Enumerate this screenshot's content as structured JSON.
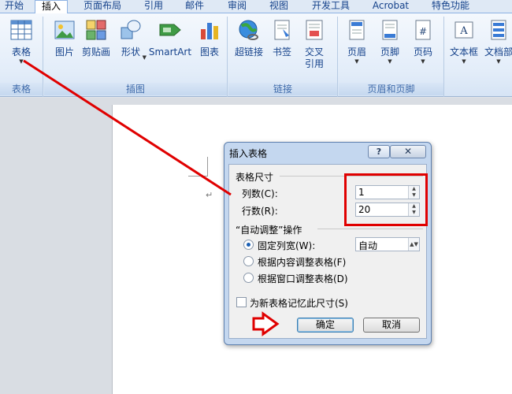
{
  "tabs": [
    {
      "label": "开始",
      "active": false
    },
    {
      "label": "插入",
      "active": true
    },
    {
      "label": "页面布局",
      "active": false
    },
    {
      "label": "引用",
      "active": false
    },
    {
      "label": "邮件",
      "active": false
    },
    {
      "label": "审阅",
      "active": false
    },
    {
      "label": "视图",
      "active": false
    },
    {
      "label": "开发工具",
      "active": false
    },
    {
      "label": "Acrobat",
      "active": false
    },
    {
      "label": "特色功能",
      "active": false
    }
  ],
  "ribbon": {
    "groups": [
      {
        "label": "表格"
      },
      {
        "label": "插图"
      },
      {
        "label": "链接"
      },
      {
        "label": "页眉和页脚"
      },
      {
        "label": ""
      }
    ],
    "buttons": {
      "table": "表格",
      "picture": "图片",
      "clipart": "剪贴画",
      "shapes": "形状",
      "smartart": "SmartArt",
      "chart": "图表",
      "hyperlink": "超链接",
      "bookmark": "书签",
      "crossref_1": "交叉",
      "crossref_2": "引用",
      "header": "页眉",
      "footer": "页脚",
      "pagenum": "页码",
      "textbox": "文本框",
      "quickparts": "文档部"
    }
  },
  "document": {
    "paragraph_mark": "↵"
  },
  "dialog": {
    "title": "插入表格",
    "help_label": "?",
    "close_label": "✕",
    "size_group": "表格尺寸",
    "columns_label": "列数(C):",
    "columns_value": "1",
    "rows_label": "行数(R):",
    "rows_value": "20",
    "autofit_group": "“自动调整”操作",
    "fixed_width_label": "固定列宽(W):",
    "fixed_width_value": "自动",
    "autofit_contents_label": "根据内容调整表格(F)",
    "autofit_window_label": "根据窗口调整表格(D)",
    "remember_label": "为新表格记忆此尺寸(S)",
    "remember_checked": false,
    "selected_option": "fixed_width",
    "ok_label": "确定",
    "cancel_label": "取消"
  },
  "colors": {
    "annotation": "#e00000",
    "ribbon_text": "#15428b",
    "dialog_frame": "#c4d7ef"
  }
}
